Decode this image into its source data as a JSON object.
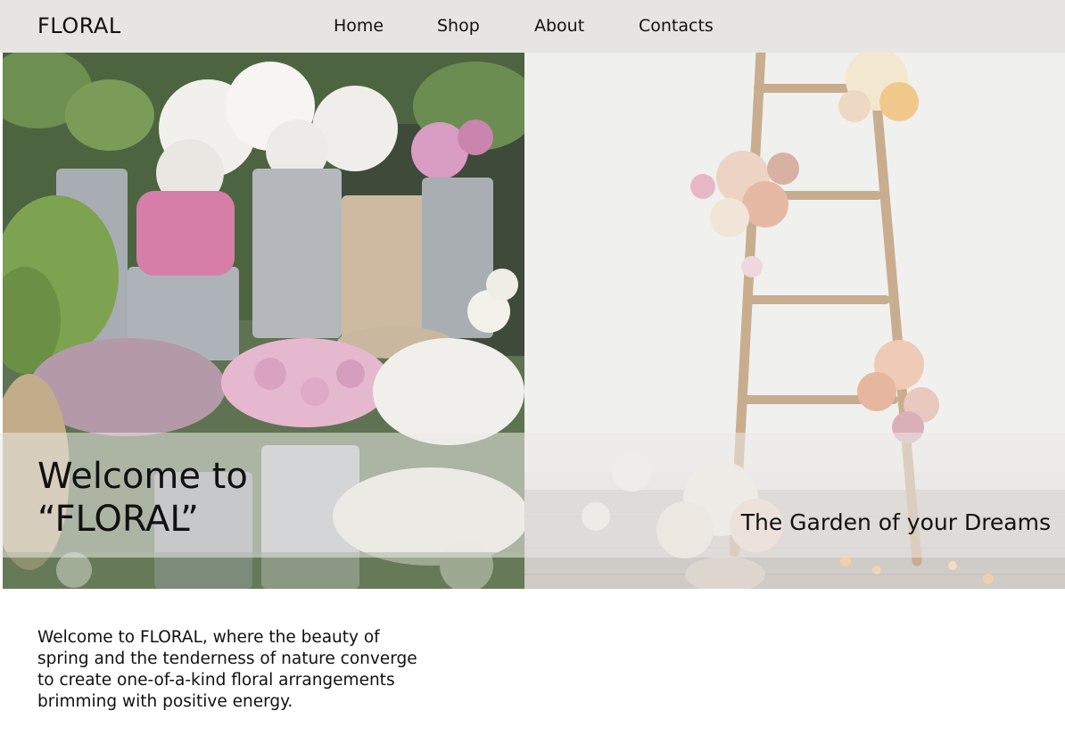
{
  "header": {
    "logo": "FLORAL",
    "nav": [
      {
        "label": "Home"
      },
      {
        "label": "Shop"
      },
      {
        "label": "About"
      },
      {
        "label": "Contacts"
      }
    ]
  },
  "hero": {
    "title_line1": "Welcome to",
    "title_line2": "“FLORAL”",
    "tagline": "The Garden of your Dreams",
    "images": {
      "left": "flower-shop-buckets-photo",
      "right": "wooden-ladder-roses-photo"
    }
  },
  "intro": {
    "text": "Welcome to FLORAL, where the beauty of spring and the tenderness of nature converge to create one-of-a-kind floral arrangements brimming with positive energy."
  },
  "colors": {
    "header_bg": "#e6e5e3",
    "band_overlay": "#ebeae8",
    "text": "#111111"
  }
}
